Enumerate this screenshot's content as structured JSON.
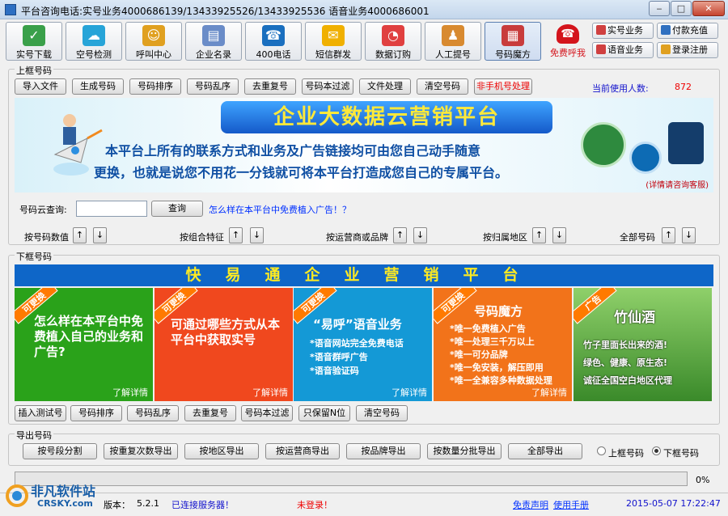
{
  "window": {
    "title": "平台咨询电话:实号业务4000686139/13433925526/13433925536  语音业务4000686001"
  },
  "toolbar": {
    "buttons": [
      {
        "label": "实号下载",
        "icon": "download-icon",
        "color": "#3aa04a"
      },
      {
        "label": "空号检测",
        "icon": "cloud-upload-icon",
        "color": "#27a4d8"
      },
      {
        "label": "呼叫中心",
        "icon": "people-icon",
        "color": "#e0a020"
      },
      {
        "label": "企业名录",
        "icon": "directory-icon",
        "color": "#6a8cc8"
      },
      {
        "label": "400电话",
        "icon": "phone-icon",
        "color": "#1a6fbf"
      },
      {
        "label": "短信群发",
        "icon": "sms-icon",
        "color": "#f0b000"
      },
      {
        "label": "数据订购",
        "icon": "pie-chart-icon",
        "color": "#e04040"
      },
      {
        "label": "人工提号",
        "icon": "person-icon",
        "color": "#d88a30"
      },
      {
        "label": "号码魔方",
        "icon": "cube-icon",
        "color": "#c83c3c"
      }
    ],
    "free_call": "免费呼我",
    "side_buttons": {
      "real_business": "实号业务",
      "pay_recharge": "付款充值",
      "voice_business": "语音业务",
      "login_register": "登录注册"
    }
  },
  "upper_frame": {
    "label": "上框号码",
    "buttons": [
      "导入文件",
      "生成号码",
      "号码排序",
      "号码乱序",
      "去重复号",
      "号码本过滤",
      "文件处理",
      "清空号码",
      "非手机号处理"
    ],
    "users_label": "当前使用人数:",
    "users_count": "872"
  },
  "banner": {
    "headline": "企业大数据云营销平台",
    "body1": "本平台上所有的联系方式和业务及广告链接均可由您自己动手随意",
    "body2": "更换，也就是说您不用花一分钱就可将本平台打造成您自己的专属平台。",
    "detail": "(详情请咨询客服)"
  },
  "query": {
    "label": "号码云查询:",
    "value": "",
    "button": "查询",
    "link": "怎么样在本平台中免费植入广告！？"
  },
  "sorts": [
    {
      "label": "按号码数值",
      "up": "↑",
      "down": "↓"
    },
    {
      "label": "按组合特征",
      "up": "↑",
      "down": "↓"
    },
    {
      "label": "按运营商或品牌",
      "up": "↑",
      "down": "↓"
    },
    {
      "label": "按归属地区",
      "up": "↑",
      "down": "↓"
    },
    {
      "label": "全部号码",
      "up": "↑",
      "down": "↓"
    }
  ],
  "lower_frame": {
    "label": "下框号码",
    "title": "快易通企业营销平台",
    "cards": [
      {
        "ribbon": "可更换",
        "title": "怎么样在本平台中免费植入自己的业务和广告?",
        "lines": [],
        "more": "了解详情",
        "color": "#2aa21a"
      },
      {
        "ribbon": "可更换",
        "title": "可通过哪些方式从本平台中获取实号",
        "lines": [],
        "more": "了解详情",
        "color": "#f0481e"
      },
      {
        "ribbon": "可更换",
        "title": "“易呼”语音业务",
        "lines": [
          "*语音网站完全免费电话",
          "*语音群呼广告",
          "*语音验证码"
        ],
        "more": "了解详情",
        "color": "#1499d6"
      },
      {
        "ribbon": "可更换",
        "title": "号码魔方",
        "lines": [
          "*唯一免费植入广告",
          "*唯一处理三千万以上",
          "*唯一可分品牌",
          "*唯一免安装，解压即用",
          "*唯一全兼容多种数据处理"
        ],
        "more": "了解详情",
        "color": "#f2731a"
      },
      {
        "ribbon": "广告",
        "title": "竹仙酒",
        "lines": [
          "竹子里面长出来的酒!",
          "绿色、健康、原生态!",
          "诚征全国空白地区代理"
        ],
        "more": "",
        "color": "#5a9a3a"
      }
    ],
    "buttons": [
      "插入测试号",
      "号码排序",
      "号码乱序",
      "去重复号",
      "号码本过滤",
      "只保留N位",
      "清空号码"
    ]
  },
  "export": {
    "label": "导出号码",
    "buttons": [
      "按号段分割",
      "按重复次数导出",
      "按地区导出",
      "按运营商导出",
      "按品牌导出",
      "按数量分批导出",
      "全部导出"
    ],
    "radio_upper": "上框号码",
    "radio_lower": "下框号码",
    "selected": "lower"
  },
  "progress": {
    "percent": 0,
    "text": "0%"
  },
  "status": {
    "version_label": "版本：",
    "version": "5.2.1",
    "server": "已连接服务器！",
    "login": "未登录！",
    "disclaimer": "免责声明",
    "manual": "使用手册",
    "datetime": "2015-05-07  17:22:47"
  },
  "watermark": {
    "line1": "非凡软件站",
    "line2": "CRSKY.com"
  }
}
